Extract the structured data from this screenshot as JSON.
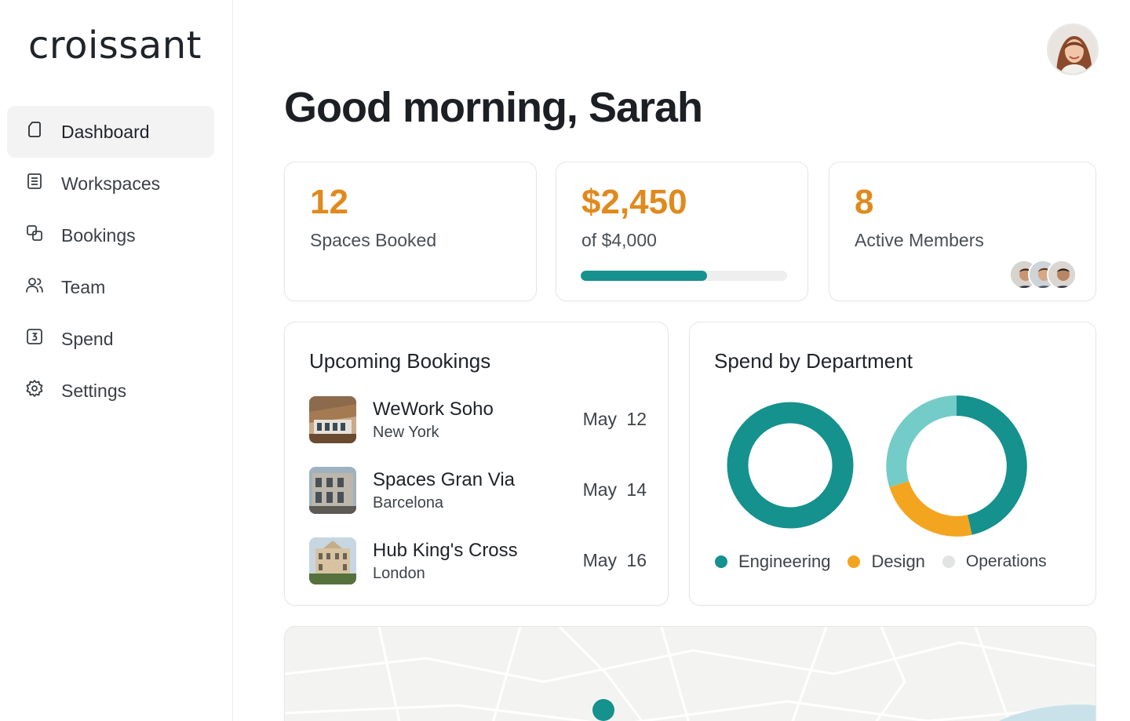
{
  "brand": {
    "logo_text": "croissant"
  },
  "nav": {
    "items": [
      {
        "label": "Dashboard",
        "icon": "dashboard-icon",
        "active": true
      },
      {
        "label": "Workspaces",
        "icon": "document-icon",
        "active": false
      },
      {
        "label": "Bookings",
        "icon": "copy-icon",
        "active": false
      },
      {
        "label": "Team",
        "icon": "users-icon",
        "active": false
      },
      {
        "label": "Spend",
        "icon": "number-icon",
        "active": false
      },
      {
        "label": "Settings",
        "icon": "gear-icon",
        "active": false
      }
    ]
  },
  "header": {
    "greeting": "Good morning, Sarah"
  },
  "stats": {
    "spaces": {
      "value": "12",
      "label": "Spaces Booked"
    },
    "spend": {
      "value": "$2,450",
      "label": "of $4,000",
      "progress": 0.6125
    },
    "members": {
      "value": "8",
      "label": "Active Members"
    }
  },
  "bookings": {
    "title": "Upcoming Bookings",
    "items": [
      {
        "name": "WeWork Soho",
        "city": "New York",
        "date": "May 12"
      },
      {
        "name": "Spaces Gran Via",
        "city": "Barcelona",
        "date": "May 14"
      },
      {
        "name": "Hub King's Cross",
        "city": "London",
        "date": "May 16"
      }
    ]
  },
  "spend_chart": {
    "title": "Spend by Department",
    "legend": [
      {
        "label": "Engineering",
        "color": "#15918e"
      },
      {
        "label": "Design",
        "color": "#f3a520"
      },
      {
        "label": "Operations",
        "color": "#e2e4e3"
      }
    ]
  },
  "colors": {
    "accent_orange": "#e08a1e",
    "accent_teal": "#15918e",
    "teal_light": "#73ccc7",
    "design_orange": "#f3a520"
  }
}
